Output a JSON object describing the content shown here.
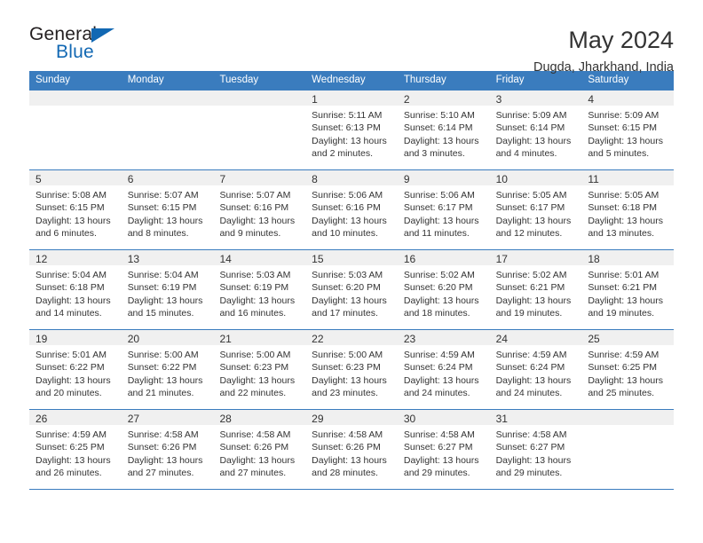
{
  "logo": {
    "general": "General",
    "blue": "Blue",
    "accent_color": "#1268b3"
  },
  "header": {
    "title": "May 2024",
    "subtitle": "Dugda, Jharkhand, India"
  },
  "calendar": {
    "header_color": "#3a7cbe",
    "weekdays": [
      "Sunday",
      "Monday",
      "Tuesday",
      "Wednesday",
      "Thursday",
      "Friday",
      "Saturday"
    ],
    "weeks": [
      [
        {
          "day": "",
          "lines": []
        },
        {
          "day": "",
          "lines": []
        },
        {
          "day": "",
          "lines": []
        },
        {
          "day": "1",
          "lines": [
            "Sunrise: 5:11 AM",
            "Sunset: 6:13 PM",
            "Daylight: 13 hours",
            "and 2 minutes."
          ]
        },
        {
          "day": "2",
          "lines": [
            "Sunrise: 5:10 AM",
            "Sunset: 6:14 PM",
            "Daylight: 13 hours",
            "and 3 minutes."
          ]
        },
        {
          "day": "3",
          "lines": [
            "Sunrise: 5:09 AM",
            "Sunset: 6:14 PM",
            "Daylight: 13 hours",
            "and 4 minutes."
          ]
        },
        {
          "day": "4",
          "lines": [
            "Sunrise: 5:09 AM",
            "Sunset: 6:15 PM",
            "Daylight: 13 hours",
            "and 5 minutes."
          ]
        }
      ],
      [
        {
          "day": "5",
          "lines": [
            "Sunrise: 5:08 AM",
            "Sunset: 6:15 PM",
            "Daylight: 13 hours",
            "and 6 minutes."
          ]
        },
        {
          "day": "6",
          "lines": [
            "Sunrise: 5:07 AM",
            "Sunset: 6:15 PM",
            "Daylight: 13 hours",
            "and 8 minutes."
          ]
        },
        {
          "day": "7",
          "lines": [
            "Sunrise: 5:07 AM",
            "Sunset: 6:16 PM",
            "Daylight: 13 hours",
            "and 9 minutes."
          ]
        },
        {
          "day": "8",
          "lines": [
            "Sunrise: 5:06 AM",
            "Sunset: 6:16 PM",
            "Daylight: 13 hours",
            "and 10 minutes."
          ]
        },
        {
          "day": "9",
          "lines": [
            "Sunrise: 5:06 AM",
            "Sunset: 6:17 PM",
            "Daylight: 13 hours",
            "and 11 minutes."
          ]
        },
        {
          "day": "10",
          "lines": [
            "Sunrise: 5:05 AM",
            "Sunset: 6:17 PM",
            "Daylight: 13 hours",
            "and 12 minutes."
          ]
        },
        {
          "day": "11",
          "lines": [
            "Sunrise: 5:05 AM",
            "Sunset: 6:18 PM",
            "Daylight: 13 hours",
            "and 13 minutes."
          ]
        }
      ],
      [
        {
          "day": "12",
          "lines": [
            "Sunrise: 5:04 AM",
            "Sunset: 6:18 PM",
            "Daylight: 13 hours",
            "and 14 minutes."
          ]
        },
        {
          "day": "13",
          "lines": [
            "Sunrise: 5:04 AM",
            "Sunset: 6:19 PM",
            "Daylight: 13 hours",
            "and 15 minutes."
          ]
        },
        {
          "day": "14",
          "lines": [
            "Sunrise: 5:03 AM",
            "Sunset: 6:19 PM",
            "Daylight: 13 hours",
            "and 16 minutes."
          ]
        },
        {
          "day": "15",
          "lines": [
            "Sunrise: 5:03 AM",
            "Sunset: 6:20 PM",
            "Daylight: 13 hours",
            "and 17 minutes."
          ]
        },
        {
          "day": "16",
          "lines": [
            "Sunrise: 5:02 AM",
            "Sunset: 6:20 PM",
            "Daylight: 13 hours",
            "and 18 minutes."
          ]
        },
        {
          "day": "17",
          "lines": [
            "Sunrise: 5:02 AM",
            "Sunset: 6:21 PM",
            "Daylight: 13 hours",
            "and 19 minutes."
          ]
        },
        {
          "day": "18",
          "lines": [
            "Sunrise: 5:01 AM",
            "Sunset: 6:21 PM",
            "Daylight: 13 hours",
            "and 19 minutes."
          ]
        }
      ],
      [
        {
          "day": "19",
          "lines": [
            "Sunrise: 5:01 AM",
            "Sunset: 6:22 PM",
            "Daylight: 13 hours",
            "and 20 minutes."
          ]
        },
        {
          "day": "20",
          "lines": [
            "Sunrise: 5:00 AM",
            "Sunset: 6:22 PM",
            "Daylight: 13 hours",
            "and 21 minutes."
          ]
        },
        {
          "day": "21",
          "lines": [
            "Sunrise: 5:00 AM",
            "Sunset: 6:23 PM",
            "Daylight: 13 hours",
            "and 22 minutes."
          ]
        },
        {
          "day": "22",
          "lines": [
            "Sunrise: 5:00 AM",
            "Sunset: 6:23 PM",
            "Daylight: 13 hours",
            "and 23 minutes."
          ]
        },
        {
          "day": "23",
          "lines": [
            "Sunrise: 4:59 AM",
            "Sunset: 6:24 PM",
            "Daylight: 13 hours",
            "and 24 minutes."
          ]
        },
        {
          "day": "24",
          "lines": [
            "Sunrise: 4:59 AM",
            "Sunset: 6:24 PM",
            "Daylight: 13 hours",
            "and 24 minutes."
          ]
        },
        {
          "day": "25",
          "lines": [
            "Sunrise: 4:59 AM",
            "Sunset: 6:25 PM",
            "Daylight: 13 hours",
            "and 25 minutes."
          ]
        }
      ],
      [
        {
          "day": "26",
          "lines": [
            "Sunrise: 4:59 AM",
            "Sunset: 6:25 PM",
            "Daylight: 13 hours",
            "and 26 minutes."
          ]
        },
        {
          "day": "27",
          "lines": [
            "Sunrise: 4:58 AM",
            "Sunset: 6:26 PM",
            "Daylight: 13 hours",
            "and 27 minutes."
          ]
        },
        {
          "day": "28",
          "lines": [
            "Sunrise: 4:58 AM",
            "Sunset: 6:26 PM",
            "Daylight: 13 hours",
            "and 27 minutes."
          ]
        },
        {
          "day": "29",
          "lines": [
            "Sunrise: 4:58 AM",
            "Sunset: 6:26 PM",
            "Daylight: 13 hours",
            "and 28 minutes."
          ]
        },
        {
          "day": "30",
          "lines": [
            "Sunrise: 4:58 AM",
            "Sunset: 6:27 PM",
            "Daylight: 13 hours",
            "and 29 minutes."
          ]
        },
        {
          "day": "31",
          "lines": [
            "Sunrise: 4:58 AM",
            "Sunset: 6:27 PM",
            "Daylight: 13 hours",
            "and 29 minutes."
          ]
        },
        {
          "day": "",
          "lines": []
        }
      ]
    ]
  }
}
